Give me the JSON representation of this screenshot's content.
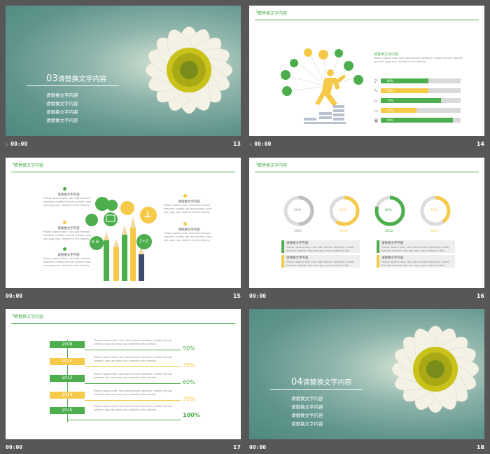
{
  "slides": [
    {
      "num": "13",
      "time": "00:00",
      "title_num": "03",
      "title": "请替换文字内容",
      "items": [
        "请替换文字内容",
        "请替换文字内容",
        "请替换文字内容",
        "请替换文字内容"
      ]
    },
    {
      "num": "14",
      "time": "00:00",
      "header": "请替换文字内容",
      "text_title": "请替换文字内容",
      "text_body": "Please replace text, click add relevant headline, modify the text content, also can copy your content to this directly.",
      "bars": [
        {
          "label": "60%",
          "value": 60
        },
        {
          "label": "60%",
          "value": 60
        },
        {
          "label": "75%",
          "value": 75
        },
        {
          "label": "45%",
          "value": 45
        },
        {
          "label": "90%",
          "value": 90
        }
      ]
    },
    {
      "num": "15",
      "time": "00:00",
      "header": "请替换文字内容",
      "blocks": [
        {
          "title": "请替换文字内容",
          "body": "Please replace text, click add relevant headline, modify the text content, also can copy your content to this directly."
        },
        {
          "title": "请替换文字内容",
          "body": "Please replace text, click add relevant headline, modify the text content, also can copy your content to this directly."
        },
        {
          "title": "请替换文字内容",
          "body": "Please replace text, click add relevant headline, modify the text content, also can copy your content to this directly."
        },
        {
          "title": "请替换文字内容",
          "body": "Please replace text, click add relevant headline, modify the text content, also can copy your content to this directly."
        },
        {
          "title": "请替换文字内容",
          "body": "Please replace text, click add relevant headline, modify the text content, also can copy your content to this directly."
        }
      ],
      "bubbles": [
        "A B",
        "2+2"
      ]
    },
    {
      "num": "16",
      "time": "00:00",
      "header": "请替换文字内容",
      "donuts": [
        {
          "year": "2001",
          "pct": "50%",
          "color": "#bfbfbf"
        },
        {
          "year": "2010",
          "pct": "60%",
          "color": "#f7c948"
        },
        {
          "year": "2012",
          "pct": "80%",
          "color": "#4cae4c"
        },
        {
          "year": "2015",
          "pct": "40%",
          "color": "#f7c948"
        }
      ],
      "boxes": [
        {
          "title": "请替换文字内容",
          "body": "Please replace text, click add relevant headline, modify the text content, also can copy your content to this directly."
        },
        {
          "title": "请替换文字内容",
          "body": "Please replace text, click add relevant headline, modify the text content, also can copy your content to this directly."
        },
        {
          "title": "请替换文字内容",
          "body": "Please replace text, click add relevant headline, modify the text content, also can copy your content to this directly."
        },
        {
          "title": "请替换文字内容",
          "body": "Please replace text, click add relevant headline, modify the text content, also can copy your content to this directly."
        }
      ]
    },
    {
      "num": "17",
      "time": "00:00",
      "header": "请替换文字内容",
      "timeline": [
        {
          "year": "2008",
          "pct": "50%"
        },
        {
          "year": "2010",
          "pct": "70%"
        },
        {
          "year": "2012",
          "pct": "60%"
        },
        {
          "year": "2014",
          "pct": "30%"
        },
        {
          "year": "2015",
          "pct": "100%"
        }
      ],
      "para": "Please replace text, click add relevant headline, modify the text content, also can copy your content to this directly."
    },
    {
      "num": "18",
      "time": "00:00",
      "title_num": "04",
      "title": "请替换文字内容",
      "items": [
        "请替换文字内容",
        "请替换文字内容",
        "请替换文字内容",
        "请替换文字内容"
      ]
    }
  ],
  "colors": {
    "green": "#4cae4c",
    "yellow": "#f7c948",
    "grey": "#d9d9d9",
    "background": "#575757"
  }
}
